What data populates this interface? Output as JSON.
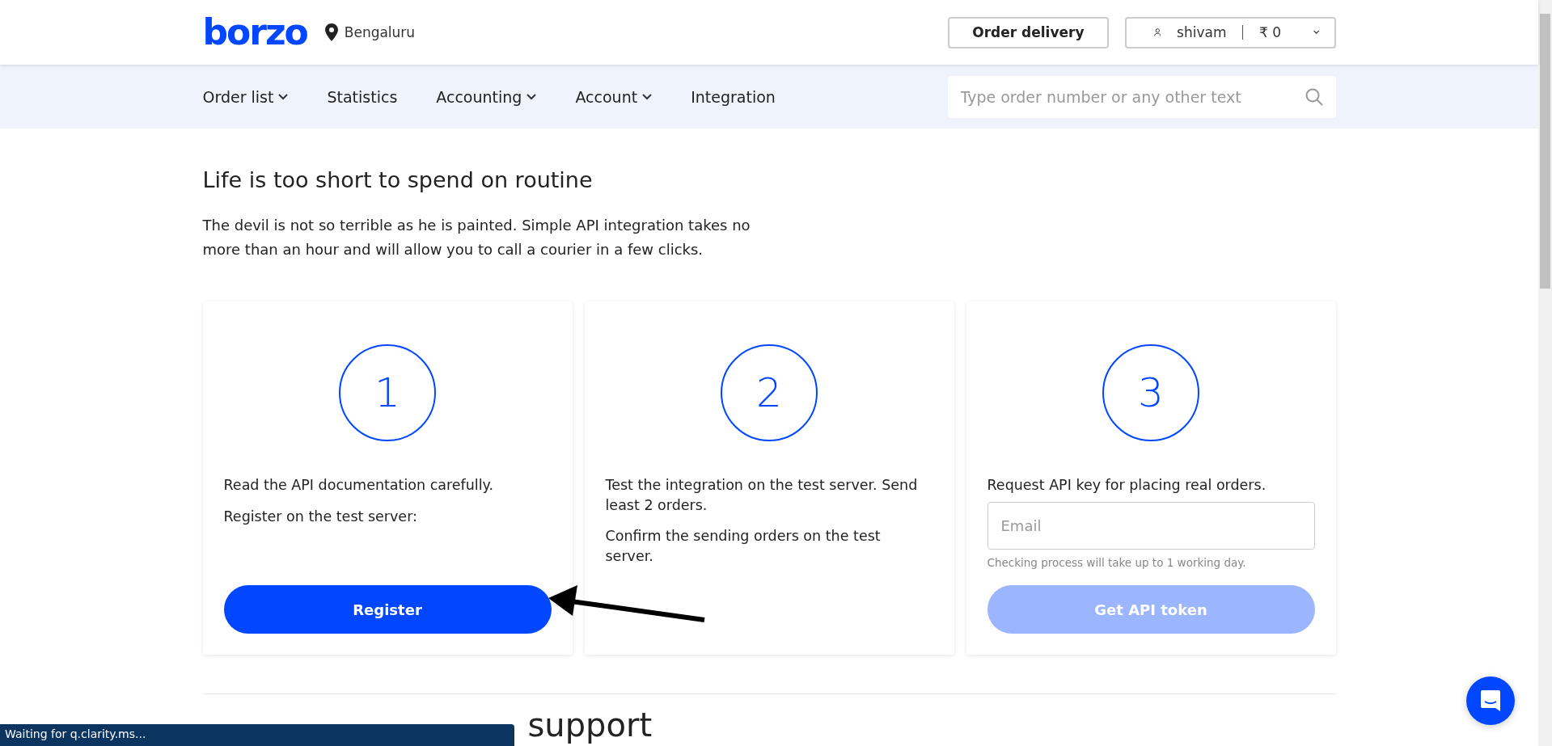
{
  "header": {
    "logo": "borzo",
    "city": "Bengaluru",
    "order_button": "Order delivery",
    "user": {
      "name": "shivam",
      "balance": "₹ 0"
    }
  },
  "nav": {
    "items": [
      {
        "label": "Order list",
        "dropdown": true
      },
      {
        "label": "Statistics",
        "dropdown": false
      },
      {
        "label": "Accounting",
        "dropdown": true
      },
      {
        "label": "Account",
        "dropdown": true
      },
      {
        "label": "Integration",
        "dropdown": false
      }
    ],
    "search": {
      "placeholder": "Type order number or any other text"
    }
  },
  "intro": {
    "title": "Life is too short to spend on routine",
    "text": "The devil is not so terrible as he is painted. Simple API integration takes no more than an hour and will allow you to call a courier in a few clicks."
  },
  "steps": [
    {
      "number": "1",
      "texts": [
        "Read the API documentation carefully.",
        "Register on the test server:"
      ],
      "button": {
        "label": "Register",
        "disabled": false
      }
    },
    {
      "number": "2",
      "texts": [
        "Test the integration on the test server. Send least 2 orders.",
        "Confirm the sending orders on the test server."
      ]
    },
    {
      "number": "3",
      "texts": [
        "Request API key for placing real orders."
      ],
      "field": {
        "placeholder": "Email"
      },
      "hint": "Checking process will take up to 1 working day.",
      "button": {
        "label": "Get API token",
        "disabled": true
      }
    }
  ],
  "next_section": {
    "title": "support"
  },
  "status_bar": "Waiting for q.clarity.ms..."
}
